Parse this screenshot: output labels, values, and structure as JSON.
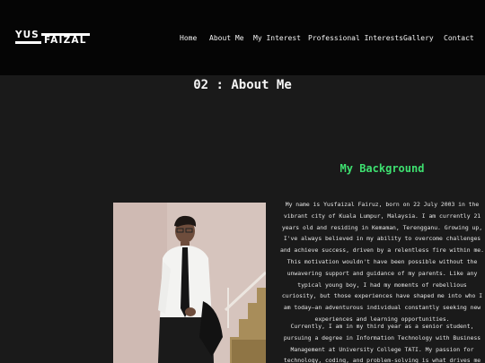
{
  "header": {
    "logo_top": "YUS",
    "logo_bottom": "FAIZAL"
  },
  "nav": {
    "items": [
      {
        "label": "Home"
      },
      {
        "label": "About Me"
      },
      {
        "label": "My Interest"
      },
      {
        "label": "Professional Interests"
      },
      {
        "label": "Gallery"
      },
      {
        "label": "Contact"
      }
    ]
  },
  "about": {
    "title": "02 : About Me",
    "subtitle": "My Background",
    "paragraph1": "My name is Yusfaizal Fairuz, born on 22 July 2003 in the vibrant city of Kuala Lumpur, Malaysia. I am currently 21 years old and residing in Kemaman, Terengganu. Growing up, I've always believed in my ability to overcome challenges and achieve success, driven by a relentless fire within me. This motivation wouldn't have been possible without the unwavering support and guidance of my parents. Like any typical young boy, I had my moments of rebellious curiosity, but those experiences have shaped me into who I am today—an adventurous individual constantly seeking new experiences and learning opportunities.",
    "paragraph2": "Currently, I am in my third year as a senior student, pursuing a degree in Information Technology with Business Management at University College TATI. My passion for technology, coding, and problem-solving is what drives me"
  },
  "colors": {
    "accent": "#3ee070",
    "header_bg": "#050505",
    "page_bg": "#1a1a1a"
  }
}
